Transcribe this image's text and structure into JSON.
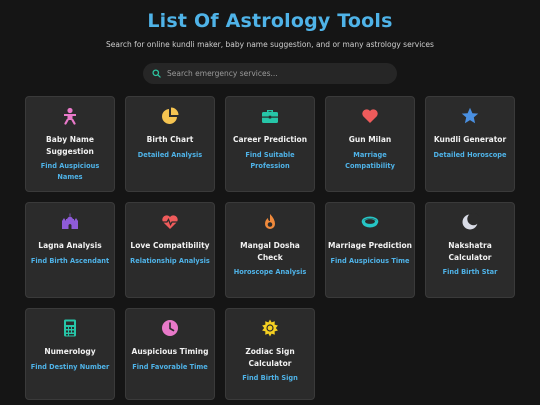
{
  "header": {
    "title": "List Of Astrology Tools",
    "subtitle": "Search for online kundli maker, baby name suggestion, and or many astrology services"
  },
  "search": {
    "placeholder": "Search emergency services..."
  },
  "colors": {
    "accent": "#4fb3e8",
    "background": "#151515",
    "card": "#2b2b2b"
  },
  "tools": [
    {
      "title": "Baby Name Suggestion",
      "desc": "Find Auspicious Names",
      "icon": "baby-icon",
      "color": "#e879c9"
    },
    {
      "title": "Birth Chart",
      "desc": "Detailed Analysis",
      "icon": "pie-chart-icon",
      "color": "#f5c451"
    },
    {
      "title": "Career Prediction",
      "desc": "Find Suitable Profession",
      "icon": "briefcase-icon",
      "color": "#26c6a8"
    },
    {
      "title": "Gun Milan",
      "desc": "Marriage Compatibility",
      "icon": "heart-icon",
      "color": "#ef5b5b"
    },
    {
      "title": "Kundli Generator",
      "desc": "Detailed Horoscope",
      "icon": "star-icon",
      "color": "#4a90e2"
    },
    {
      "title": "Lagna Analysis",
      "desc": "Find Birth Ascendant",
      "icon": "temple-icon",
      "color": "#8e5bd8"
    },
    {
      "title": "Love Compatibility",
      "desc": "Relationship Analysis",
      "icon": "heart-pulse-icon",
      "color": "#ef5b5b"
    },
    {
      "title": "Mangal Dosha Check",
      "desc": "Horoscope Analysis",
      "icon": "fire-icon",
      "color": "#f08a3c"
    },
    {
      "title": "Marriage Prediction",
      "desc": "Find Auspicious Time",
      "icon": "ring-icon",
      "color": "#26c6c6"
    },
    {
      "title": "Nakshatra Calculator",
      "desc": "Find Birth Star",
      "icon": "moon-icon",
      "color": "#d9dce6"
    },
    {
      "title": "Numerology",
      "desc": "Find Destiny Number",
      "icon": "calculator-icon",
      "color": "#26c6a8"
    },
    {
      "title": "Auspicious Timing",
      "desc": "Find Favorable Time",
      "icon": "clock-icon",
      "color": "#e879c9"
    },
    {
      "title": "Zodiac Sign Calculator",
      "desc": "Find Birth Sign",
      "icon": "sun-icon",
      "color": "#f5d022"
    }
  ]
}
